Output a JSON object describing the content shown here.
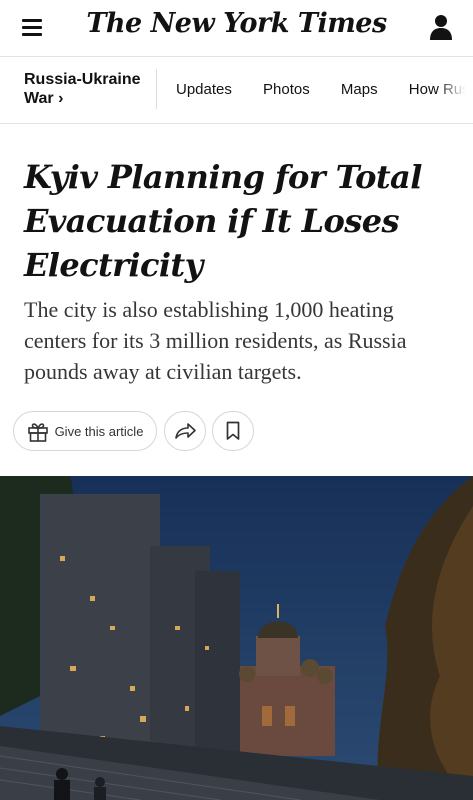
{
  "header": {
    "logo_text": "The New York Times",
    "menu_icon": "hamburger-menu-icon",
    "account_icon": "account-person-icon"
  },
  "section_nav": {
    "title": "Russia-Ukraine War ›",
    "links": [
      {
        "label": "Updates"
      },
      {
        "label": "Photos"
      },
      {
        "label": "Maps"
      },
      {
        "label": "How Russia"
      }
    ]
  },
  "article": {
    "headline": "Kyiv Planning for Total Evacuation if It Loses Electricity",
    "summary": "The city is also establishing 1,000 heating centers for its 3 million residents, as Russia pounds away at civilian targets."
  },
  "actions": {
    "gift_label": "Give this article",
    "gift_icon": "gift-icon",
    "share_icon": "share-arrow-icon",
    "save_icon": "bookmark-icon"
  },
  "colors": {
    "text": "#121212",
    "divider": "#e2e2e2",
    "sky": "#1d3456"
  }
}
